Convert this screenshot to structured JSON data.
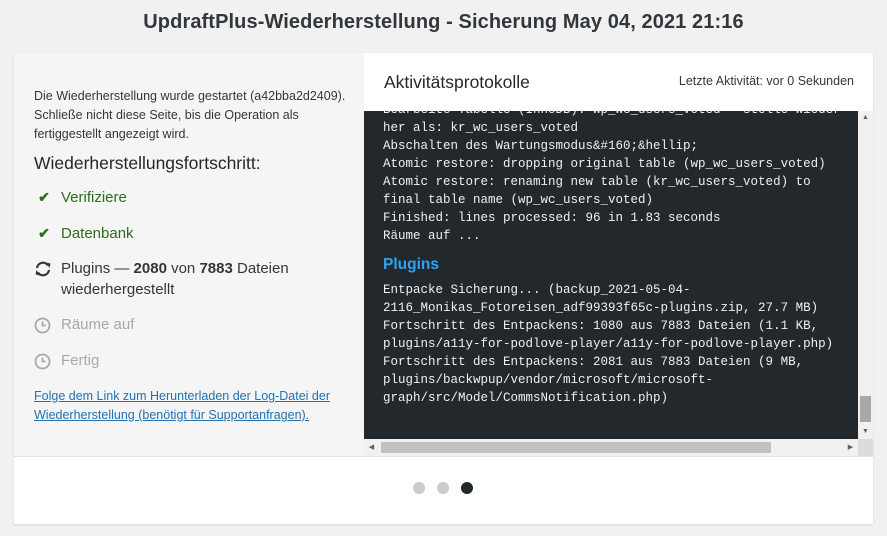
{
  "title": "UpdraftPlus-Wiederherstellung - Sicherung May 04, 2021 21:16",
  "status": {
    "started_text": "Die Wiederherstellung wurde gestartet (a42bba2d2409). Schließe nicht diese Seite, bis die Operation als fertiggestellt angezeigt wird.",
    "progress_title": "Wiederherstellungsfortschritt:",
    "steps": [
      {
        "label": "Verifiziere",
        "state": "done",
        "icon": "check-icon"
      },
      {
        "label": "Datenbank",
        "state": "done",
        "icon": "check-icon"
      },
      {
        "label_prefix": "Plugins — ",
        "count": "2080",
        "of_text": " von ",
        "total": "7883",
        "suffix": " Dateien wiederhergestellt",
        "state": "active",
        "icon": "refresh-icon"
      },
      {
        "label": "Räume auf",
        "state": "pending",
        "icon": "clock-icon"
      },
      {
        "label": "Fertig",
        "state": "pending",
        "icon": "clock-icon"
      }
    ],
    "log_link": "Folge dem Link zum Herunterladen der Log-Datei der Wiederherstellung (benötigt für Supportanfragen)."
  },
  "log": {
    "title": "Aktivitätsprotokolle",
    "last_activity": "Letzte Aktivität: vor 0 Sekunden",
    "lines_before": "Bearbeite Tabelle (InnoDB): wp_wc_users_voted - stelle wieder her als: kr_wc_users_voted\nAbschalten des Wartungsmodus&#160;&hellip;\nAtomic restore: dropping original table (wp_wc_users_voted)\nAtomic restore: renaming new table (kr_wc_users_voted) to final table name (wp_wc_users_voted)\nFinished: lines processed: 96 in 1.83 seconds\nRäume auf ...",
    "section_heading": "Plugins",
    "lines_after": "Entpacke Sicherung... (backup_2021-05-04-2116_Monikas_Fotoreisen_adf99393f65c-plugins.zip, 27.7 MB)\nFortschritt des Entpackens: 1080 aus 7883 Dateien (1.1 KB, plugins/a11y-for-podlove-player/a11y-for-podlove-player.php)\nFortschritt des Entpackens: 2081 aus 7883 Dateien (9 MB, plugins/backwpup/vendor/microsoft/microsoft-graph/src/Model/CommsNotification.php)"
  },
  "pager": {
    "pages": 3,
    "current": 3
  },
  "colors": {
    "success": "#2b6e1d",
    "link": "#2271b1",
    "console_bg": "#23282d",
    "console_heading": "#2ea3f2"
  }
}
